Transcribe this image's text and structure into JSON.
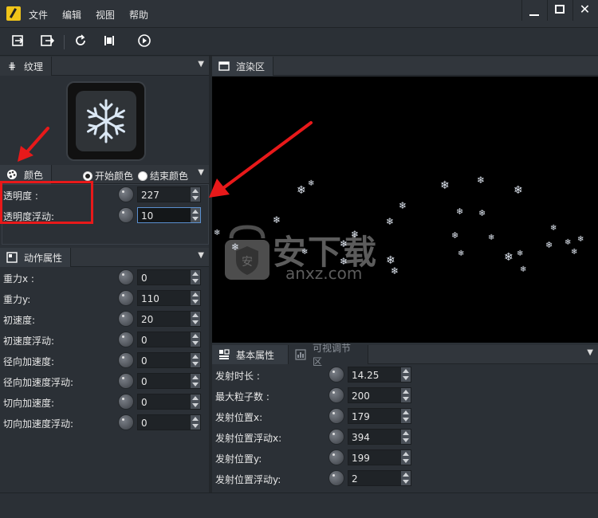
{
  "window": {
    "menu": [
      "文件",
      "编辑",
      "视图",
      "帮助"
    ],
    "controls": [
      "minimize",
      "maximize",
      "close"
    ]
  },
  "toolbar": {
    "buttons": [
      {
        "icon": "import-icon"
      },
      {
        "icon": "export-icon"
      },
      {
        "icon": "refresh-icon"
      },
      {
        "icon": "fit-icon"
      },
      {
        "icon": "play-icon"
      }
    ]
  },
  "texture_panel": {
    "title": "纹理",
    "texture_icon": "snowflake-icon"
  },
  "color_panel": {
    "title": "颜色",
    "radio_start": "开始颜色",
    "radio_end": "结束颜色",
    "selected": "开始颜色",
    "rows": [
      {
        "label": "透明度 :",
        "value": "227"
      },
      {
        "label": "透明度浮动:",
        "value": "10"
      }
    ]
  },
  "motion_panel": {
    "title": "动作属性",
    "rows": [
      {
        "label": "重力x :",
        "value": "0"
      },
      {
        "label": "重力y:",
        "value": "110"
      },
      {
        "label": "初速度:",
        "value": "20"
      },
      {
        "label": "初速度浮动:",
        "value": "0"
      },
      {
        "label": "径向加速度:",
        "value": "0"
      },
      {
        "label": "径向加速度浮动:",
        "value": "0"
      },
      {
        "label": "切向加速度:",
        "value": "0"
      },
      {
        "label": "切向加速度浮动:",
        "value": "0"
      }
    ]
  },
  "render_panel": {
    "title": "渲染区"
  },
  "basic_panel": {
    "tab_basic": "基本属性",
    "tab_visual": "可视调节区",
    "rows": [
      {
        "label": "发射时长 :",
        "value": "14.25"
      },
      {
        "label": "最大粒子数 :",
        "value": "200"
      },
      {
        "label": "发射位置x:",
        "value": "179"
      },
      {
        "label": "发射位置浮动x:",
        "value": "394"
      },
      {
        "label": "发射位置y:",
        "value": "199"
      },
      {
        "label": "发射位置浮动y:",
        "value": "2"
      }
    ]
  },
  "watermark": {
    "text": "安下载",
    "subtext": "anxz.com"
  },
  "colors": {
    "annotation": "#e8191a",
    "background": "#2b3036",
    "render_bg": "#000000"
  }
}
